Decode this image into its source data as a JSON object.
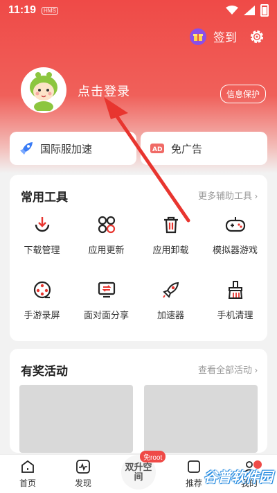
{
  "status": {
    "time": "11:19",
    "hms_badge": "HMS",
    "icons": [
      "wifi-icon",
      "signal-icon",
      "battery-icon"
    ]
  },
  "header": {
    "signin_label": "签到",
    "login_prompt": "点击登录",
    "privacy_label": "信息保护"
  },
  "quick": {
    "left": {
      "label": "国际服加速",
      "icon": "rocket-icon"
    },
    "right": {
      "label": "免广告",
      "icon": "ad-block-icon"
    }
  },
  "tools": {
    "title": "常用工具",
    "more": "更多辅助工具 ›",
    "items": [
      {
        "label": "下载管理",
        "icon": "download-icon"
      },
      {
        "label": "应用更新",
        "icon": "app-update-icon"
      },
      {
        "label": "应用卸载",
        "icon": "trash-icon"
      },
      {
        "label": "模拟器游戏",
        "icon": "gamepad-icon"
      },
      {
        "label": "手游录屏",
        "icon": "film-reel-icon"
      },
      {
        "label": "面对面分享",
        "icon": "share-screen-icon"
      },
      {
        "label": "加速器",
        "icon": "rocket-icon"
      },
      {
        "label": "手机清理",
        "icon": "broom-icon"
      }
    ]
  },
  "activities": {
    "title": "有奖活动",
    "more": "查看全部活动 ›"
  },
  "tabbar": {
    "items": [
      {
        "label": "首页",
        "icon": "home-icon"
      },
      {
        "label": "发现",
        "icon": "discover-icon"
      },
      {
        "label": "双升空间",
        "badge": "免root"
      },
      {
        "label": "推荐",
        "icon": "recommend-icon"
      },
      {
        "label": "我的",
        "icon": "profile-icon"
      }
    ]
  },
  "watermark": "谷普软件园",
  "colors": {
    "accent": "#ef4a47",
    "gift": "#8a4fe8",
    "annotation_arrow": "#e8352f"
  }
}
